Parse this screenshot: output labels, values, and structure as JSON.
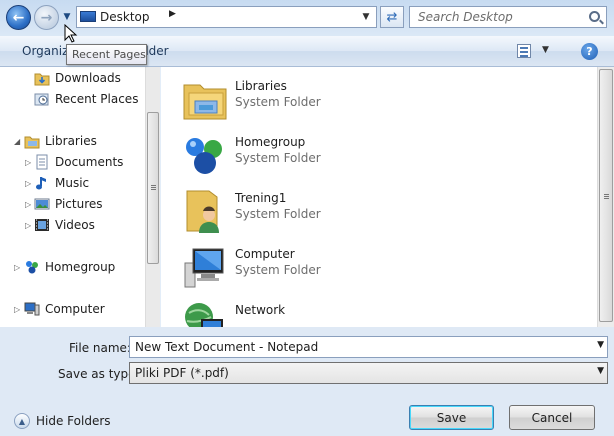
{
  "nav": {
    "address_crumb": "Desktop",
    "search_placeholder": "Search Desktop",
    "tooltip": "Recent Pages"
  },
  "toolbar": {
    "organize": "Organize",
    "new_folder": "older"
  },
  "sidebar": {
    "items": [
      {
        "label": "Downloads",
        "icon": "downloads-folder-icon"
      },
      {
        "label": "Recent Places",
        "icon": "recent-places-icon"
      },
      {
        "label": "Libraries",
        "icon": "libraries-icon"
      },
      {
        "label": "Documents",
        "icon": "documents-icon"
      },
      {
        "label": "Music",
        "icon": "music-icon"
      },
      {
        "label": "Pictures",
        "icon": "pictures-icon"
      },
      {
        "label": "Videos",
        "icon": "videos-icon"
      },
      {
        "label": "Homegroup",
        "icon": "homegroup-icon"
      },
      {
        "label": "Computer",
        "icon": "computer-icon"
      }
    ]
  },
  "files": [
    {
      "name": "Libraries",
      "type": "System Folder",
      "icon": "libraries-icon"
    },
    {
      "name": "Homegroup",
      "type": "System Folder",
      "icon": "homegroup-icon"
    },
    {
      "name": "Trening1",
      "type": "System Folder",
      "icon": "user-folder-icon"
    },
    {
      "name": "Computer",
      "type": "System Folder",
      "icon": "computer-icon"
    },
    {
      "name": "Network",
      "type": "",
      "icon": "network-icon"
    }
  ],
  "form": {
    "filename_label": "File name:",
    "filename_value": "New Text Document - Notepad",
    "savetype_label": "Save as type:",
    "savetype_value": "Pliki PDF (*.pdf)",
    "hide_folders": "Hide Folders",
    "save": "Save",
    "cancel": "Cancel"
  }
}
